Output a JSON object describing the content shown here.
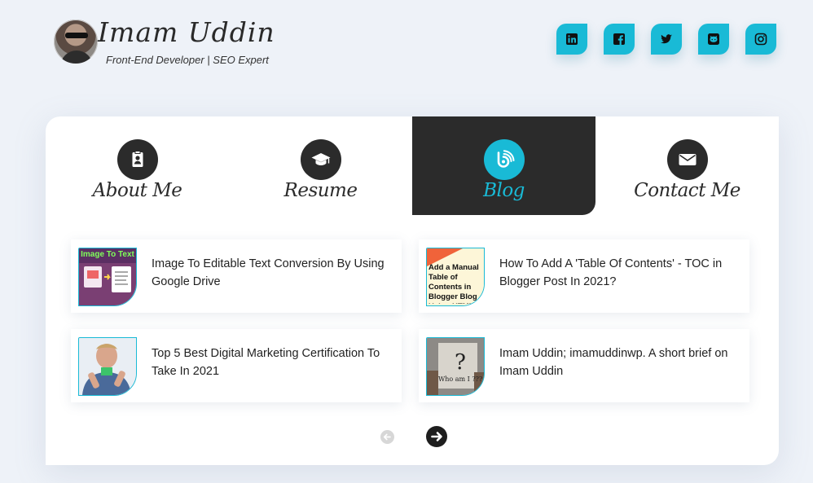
{
  "brand": {
    "name": "Imam Uddin",
    "tagline": "Front-End Developer | SEO Expert"
  },
  "socials": [
    {
      "icon": "linkedin-icon"
    },
    {
      "icon": "facebook-icon"
    },
    {
      "icon": "twitter-icon"
    },
    {
      "icon": "github-icon"
    },
    {
      "icon": "instagram-icon"
    }
  ],
  "tabs": [
    {
      "label": "About Me",
      "icon": "id-badge-icon",
      "active": false
    },
    {
      "label": "Resume",
      "icon": "graduation-cap-icon",
      "active": false
    },
    {
      "label": "Blog",
      "icon": "blogger-icon",
      "active": true
    },
    {
      "label": "Contact Me",
      "icon": "envelope-icon",
      "active": false
    }
  ],
  "posts": [
    {
      "title": "Image To Editable Text Conversion By Using Google Drive",
      "thumb_text": "Image To Text"
    },
    {
      "title": "How To Add A 'Table Of Contents' - TOC in Blogger Post In 2021?",
      "thumb_text": "Add a Manual Table of Contents in Blogger Blog Using HTML &"
    },
    {
      "title": "Top 5 Best Digital Marketing Certification To Take In 2021",
      "thumb_text": ""
    },
    {
      "title": "Imam Uddin; imamuddinwp. A short brief on Imam Uddin",
      "thumb_text": "Who am I ???"
    }
  ],
  "colors": {
    "accent": "#19bad6",
    "dark": "#2b2b2b",
    "bg": "#eef2f8"
  }
}
